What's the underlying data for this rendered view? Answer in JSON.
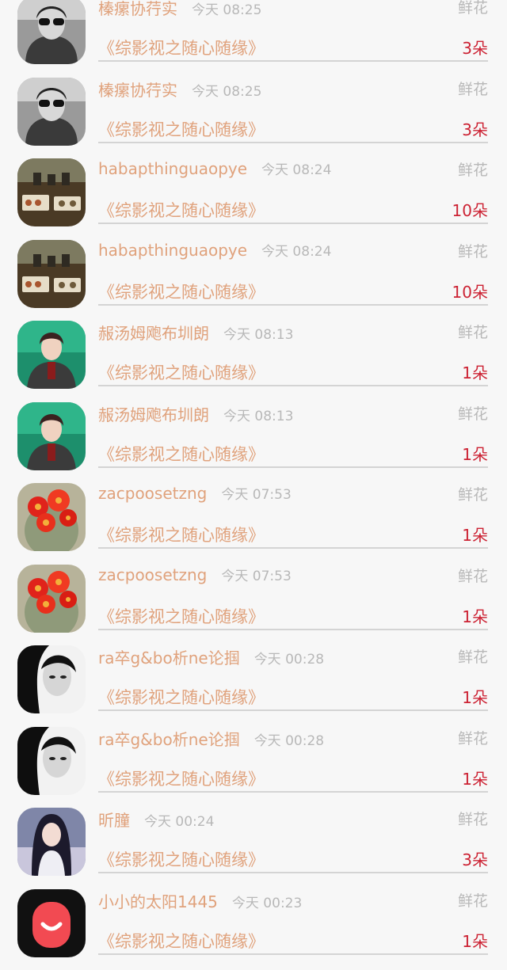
{
  "list": {
    "items": [
      {
        "name": "榛瘰协荇实",
        "time": "今天 08:25",
        "gift": "鲜花",
        "book": "《综影视之随心随缘》",
        "count": "3朵",
        "avatar": "avatar-sunglasses-woman-icon"
      },
      {
        "name": "榛瘰协荇实",
        "time": "今天 08:25",
        "gift": "鲜花",
        "book": "《综影视之随心随缘》",
        "count": "3朵",
        "avatar": "avatar-sunglasses-woman-icon"
      },
      {
        "name": "habapthinguaopye",
        "time": "今天 08:24",
        "gift": "鲜花",
        "book": "《综影视之随心随缘》",
        "count": "10朵",
        "avatar": "avatar-food-table-icon"
      },
      {
        "name": "habapthinguaopye",
        "time": "今天 08:24",
        "gift": "鲜花",
        "book": "《综影视之随心随缘》",
        "count": "10朵",
        "avatar": "avatar-food-table-icon"
      },
      {
        "name": "赧汤姆飑布圳朗",
        "time": "今天 08:13",
        "gift": "鲜花",
        "book": "《综影视之随心随缘》",
        "count": "1朵",
        "avatar": "avatar-anime-man-icon"
      },
      {
        "name": "赧汤姆飑布圳朗",
        "time": "今天 08:13",
        "gift": "鲜花",
        "book": "《综影视之随心随缘》",
        "count": "1朵",
        "avatar": "avatar-anime-man-icon"
      },
      {
        "name": "zacpoosetzng",
        "time": "今天 07:53",
        "gift": "鲜花",
        "book": "《综影视之随心随缘》",
        "count": "1朵",
        "avatar": "avatar-cactus-flower-icon"
      },
      {
        "name": "zacpoosetzng",
        "time": "今天 07:53",
        "gift": "鲜花",
        "book": "《综影视之随心随缘》",
        "count": "1朵",
        "avatar": "avatar-cactus-flower-icon"
      },
      {
        "name": "ra卒g&bo析ne论掴",
        "time": "今天 00:28",
        "gift": "鲜花",
        "book": "《综影视之随心随缘》",
        "count": "1朵",
        "avatar": "avatar-bw-portrait-icon"
      },
      {
        "name": "ra卒g&bo析ne论掴",
        "time": "今天 00:28",
        "gift": "鲜花",
        "book": "《综影视之随心随缘》",
        "count": "1朵",
        "avatar": "avatar-bw-portrait-icon"
      },
      {
        "name": "昕朣",
        "time": "今天 00:24",
        "gift": "鲜花",
        "book": "《综影视之随心随缘》",
        "count": "3朵",
        "avatar": "avatar-anime-girl-icon"
      },
      {
        "name": "小小的太阳1445",
        "time": "今天 00:23",
        "gift": "鲜花",
        "book": "《综影视之随心随缘》",
        "count": "1朵",
        "avatar": "avatar-smile-logo-icon"
      }
    ]
  },
  "colors": {
    "name": "#e0a27c",
    "time": "#b8b8b8",
    "count": "#cc2233",
    "background": "#f7f7f7",
    "divider": "#d4d4d4"
  }
}
